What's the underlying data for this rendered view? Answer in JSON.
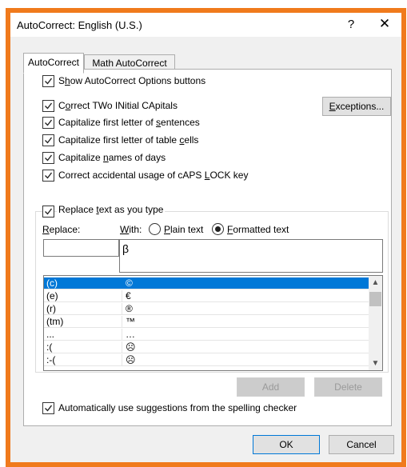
{
  "window": {
    "title": "AutoCorrect: English (U.S.)",
    "help": "?",
    "close": "✕"
  },
  "tabs": [
    {
      "label": "AutoCorrect"
    },
    {
      "label": "Math AutoCorrect"
    }
  ],
  "options": [
    {
      "pre": "S",
      "u": "h",
      "post": "ow AutoCorrect Options buttons",
      "checked": true
    },
    {
      "pre": "C",
      "u": "o",
      "post": "rrect TWo INitial CApitals",
      "checked": true
    },
    {
      "pre": "Capitalize first letter of ",
      "u": "s",
      "post": "entences",
      "checked": true
    },
    {
      "pre": "Capitalize first letter of table ",
      "u": "c",
      "post": "ells",
      "checked": true
    },
    {
      "pre": "Capitalize ",
      "u": "n",
      "post": "ames of days",
      "checked": true
    },
    {
      "pre": "Correct accidental usage of cAPS ",
      "u": "L",
      "post": "OCK key",
      "checked": true
    }
  ],
  "exceptions": {
    "pre": "",
    "u": "E",
    "post": "xceptions..."
  },
  "replace_as_type": {
    "pre": "Replace ",
    "u": "t",
    "post": "ext as you type",
    "checked": true
  },
  "replace_label": {
    "pre": "",
    "u": "R",
    "post": "eplace:"
  },
  "with_label": {
    "pre": "",
    "u": "W",
    "post": "ith:"
  },
  "plain_text": {
    "pre": "",
    "u": "P",
    "post": "lain text",
    "selected": false
  },
  "formatted_text": {
    "pre": "",
    "u": "F",
    "post": "ormatted text",
    "selected": true
  },
  "replace_value": "",
  "with_value": "β",
  "entries": [
    {
      "key": "(c)",
      "value": "©",
      "selected": true
    },
    {
      "key": "(e)",
      "value": "€",
      "selected": false
    },
    {
      "key": "(r)",
      "value": "®",
      "selected": false
    },
    {
      "key": "(tm)",
      "value": "™",
      "selected": false
    },
    {
      "key": "...",
      "value": "…",
      "selected": false
    },
    {
      "key": ":(",
      "value": "☹",
      "selected": false
    },
    {
      "key": ":-(",
      "value": "☹",
      "selected": false
    }
  ],
  "add_button": "Add",
  "delete_button": "Delete",
  "suggestions": {
    "label": "Automatically use suggestions from the spelling checker",
    "checked": true
  },
  "ok_button": "OK",
  "cancel_button": "Cancel",
  "colors": {
    "accent": "#f07a1c",
    "selection": "#0078d7"
  }
}
